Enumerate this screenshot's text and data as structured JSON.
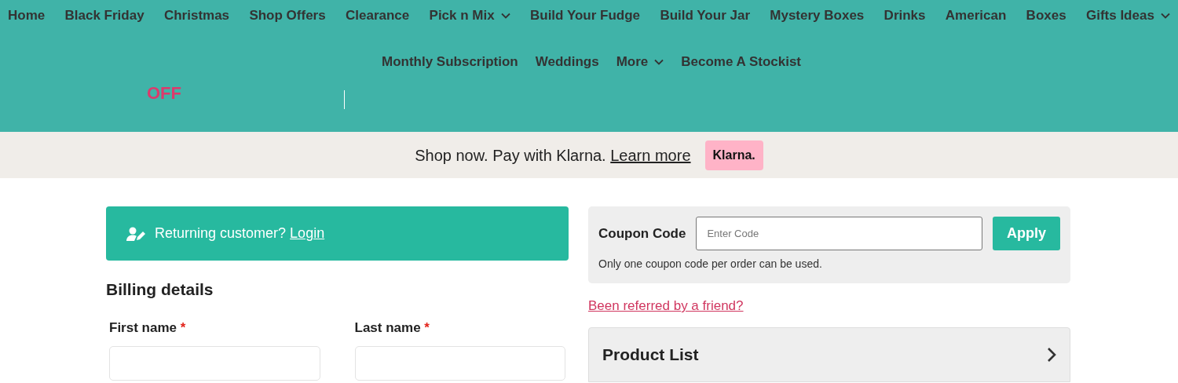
{
  "nav": {
    "primary": [
      {
        "label": "Home",
        "dropdown": false
      },
      {
        "label": "Black Friday",
        "dropdown": false
      },
      {
        "label": "Christmas",
        "dropdown": false
      },
      {
        "label": "Shop Offers",
        "dropdown": false
      },
      {
        "label": "Clearance",
        "dropdown": false
      },
      {
        "label": "Pick n Mix",
        "dropdown": true
      },
      {
        "label": "Build Your Fudge",
        "dropdown": false
      },
      {
        "label": "Build Your Jar",
        "dropdown": false
      },
      {
        "label": "Mystery Boxes",
        "dropdown": false
      },
      {
        "label": "Drinks",
        "dropdown": false
      },
      {
        "label": "American",
        "dropdown": false
      },
      {
        "label": "Boxes",
        "dropdown": false
      },
      {
        "label": "Gifts Ideas",
        "dropdown": true
      }
    ],
    "secondary": [
      {
        "label": "Monthly Subscription",
        "dropdown": false
      },
      {
        "label": "Weddings",
        "dropdown": false
      },
      {
        "label": "More",
        "dropdown": true
      },
      {
        "label": "Become A Stockist",
        "dropdown": false
      }
    ]
  },
  "promo": {
    "text": "OFF"
  },
  "klarna_bar": {
    "text": "Shop now. Pay with Klarna.",
    "link": "Learn more",
    "badge": "Klarna."
  },
  "returning_customer": {
    "text": "Returning customer?",
    "link": "Login"
  },
  "billing": {
    "title": "Billing details",
    "fields": [
      {
        "label": "First name",
        "required_mark": "*"
      },
      {
        "label": "Last name",
        "required_mark": "*"
      }
    ]
  },
  "coupon": {
    "label": "Coupon Code",
    "placeholder": "Enter Code",
    "button": "Apply",
    "note": "Only one coupon code per order can be used."
  },
  "referral_link": "Been referred by a friend?",
  "product_list": {
    "title": "Product List",
    "expanded": false
  }
}
